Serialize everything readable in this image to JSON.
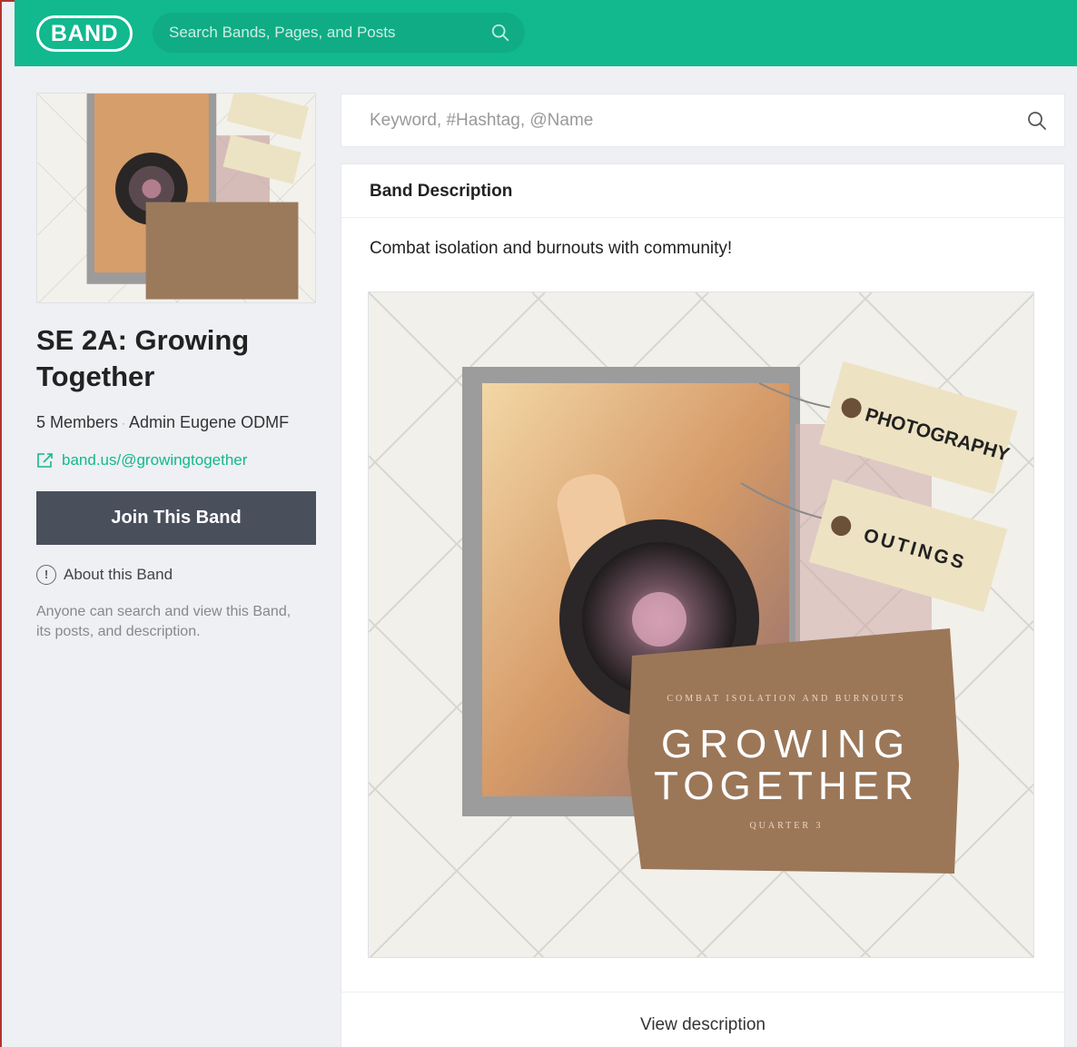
{
  "header": {
    "logo": "BAND",
    "search_placeholder": "Search Bands, Pages, and Posts"
  },
  "colors": {
    "brand_green": "#12b88e",
    "join_button": "#4a4f5c",
    "link_green": "#12b88e"
  },
  "sidebar": {
    "cover_alt": "Growing Together cover image",
    "band_name": "SE 2A: Growing Together",
    "members": "5 Members",
    "admin": "Admin Eugene ODMF",
    "link": "band.us/@growingtogether",
    "join_label": "Join This Band",
    "about_label": "About this Band",
    "about_desc": "Anyone can search and view this Band, its posts, and description."
  },
  "main": {
    "search_placeholder": "Keyword, #Hashtag, @Name",
    "section_title": "Band Description",
    "description": "Combat isolation and burnouts with community!",
    "view_label": "View description"
  },
  "cover_art": {
    "tag1": "PHOTOGRAPHY",
    "tag2": "OUTINGS",
    "kicker": "COMBAT ISOLATION AND BURNOUTS",
    "title_line1": "GROWING",
    "title_line2": "TOGETHER",
    "subline": "QUARTER 3"
  }
}
